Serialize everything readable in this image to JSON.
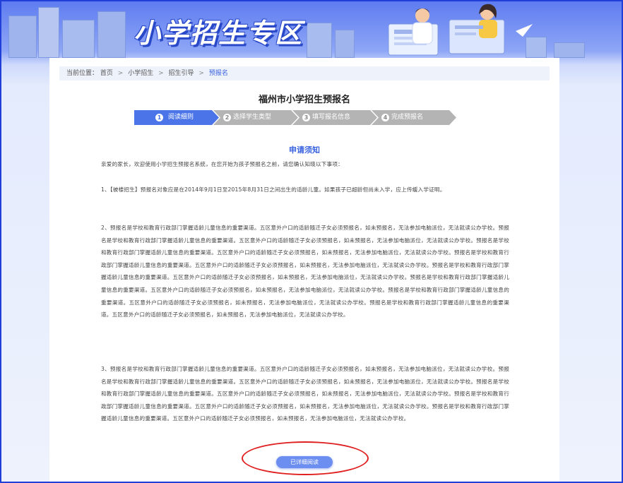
{
  "banner": {
    "title": "小学招生专区"
  },
  "breadcrumb": {
    "prefix": "当前位置：",
    "items": [
      "首页",
      "小学招生",
      "招生引导",
      "预报名"
    ],
    "separator": ">"
  },
  "page_title": "福州市小学招生预报名",
  "steps": [
    {
      "num": "1",
      "label": "阅读细则",
      "active": true
    },
    {
      "num": "2",
      "label": "选择学生类型",
      "active": false
    },
    {
      "num": "3",
      "label": "填写报名信息",
      "active": false
    },
    {
      "num": "4",
      "label": "完成预报名",
      "active": false
    }
  ],
  "notice": {
    "title": "申请须知",
    "intro": "亲爱的家长，欢迎使用小学招生预报名系统，在您开始为孩子预报名之前，请您确认知晓以下事项：",
    "items": [
      "1、【被楼招生】预报名对象应是在2014年9月1日至2015年8月31日之间出生的适龄儿童。如果孩子已超龄但尚未入学，应上传缓入学证明。",
      "2、预报名是学校和教育行政部门掌握适龄儿童信息的重要渠道。五区意外户口的适龄随迁子女必须预报名，如未预报名，无法参加电脑派位，无法就读公办学校。预报名是学校和教育行政部门掌握适龄儿童信息的重要渠道。五区意外户口的适龄随迁子女必须预报名，如未预报名，无法参加电脑派位，无法就读公办学校。预报名是学校和教育行政部门掌握适龄儿童信息的重要渠道。五区意外户口的适龄随迁子女必须预报名，如未预报名，无法参加电脑派位，无法就读公办学校。预报名是学校和教育行政部门掌握适龄儿童信息的重要渠道。五区意外户口的适龄随迁子女必须预报名，如未预报名，无法参加电脑派位，无法就读公办学校。预报名是学校和教育行政部门掌握适龄儿童信息的重要渠道。五区意外户口的适龄随迁子女必须预报名，如未预报名，无法参加电脑派位，无法就读公办学校。预报名是学校和教育行政部门掌握适龄儿童信息的重要渠道。五区意外户口的适龄随迁子女必须预报名，如未预报名，无法参加电脑派位，无法就读公办学校。预报名是学校和教育行政部门掌握适龄儿童信息的重要渠道。五区意外户口的适龄随迁子女必须预报名，如未预报名，无法参加电脑派位，无法就读公办学校。预报名是学校和教育行政部门掌握适龄儿童信息的重要渠道。五区意外户口的适龄随迁子女必须预报名，如未预报名，无法参加电脑派位，无法就读公办学校。",
      "3、预报名是学校和教育行政部门掌握适龄儿童信息的重要渠道。五区意外户口的适龄随迁子女必须预报名，如未预报名，无法参加电脑派位，无法就读公办学校。预报名是学校和教育行政部门掌握适龄儿童信息的重要渠道。五区意外户口的适龄随迁子女必须预报名，如未预报名，无法参加电脑派位，无法就读公办学校。预报名是学校和教育行政部门掌握适龄儿童信息的重要渠道。五区意外户口的适龄随迁子女必须预报名，如未预报名，无法参加电脑派位，无法就读公办学校。预报名是学校和教育行政部门掌握适龄儿童信息的重要渠道。五区意外户口的适龄随迁子女必须预报名，如未预报名，无法参加电脑派位，无法就读公办学校。预报名是学校和教育行政部门掌握适龄儿童信息的重要渠道。五区意外户口的适龄随迁子女必须预报名，如未预报名，无法参加电脑派位，无法就读公办学校。"
    ]
  },
  "read_button": {
    "label": "已详细阅读"
  },
  "colors": {
    "accent": "#3a63e0",
    "step_active": "#4a74e8",
    "step_inactive": "#b4b4b4",
    "highlight_ellipse": "#e02020"
  }
}
